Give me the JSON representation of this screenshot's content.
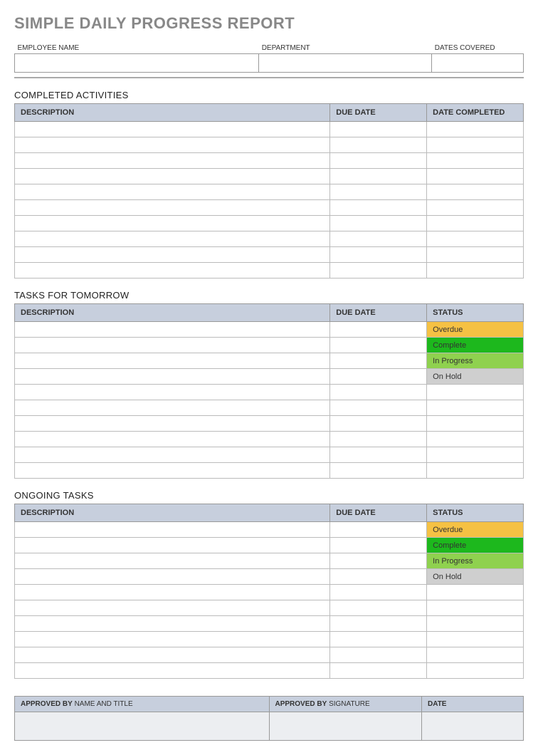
{
  "title": "SIMPLE DAILY PROGRESS REPORT",
  "header": {
    "employee_label": "EMPLOYEE NAME",
    "department_label": "DEPARTMENT",
    "dates_label": "DATES COVERED",
    "employee_value": "",
    "department_value": "",
    "dates_value": ""
  },
  "completed": {
    "title": "COMPLETED ACTIVITIES",
    "col_description": "DESCRIPTION",
    "col_due": "DUE DATE",
    "col_completed": "DATE COMPLETED",
    "rows": [
      {
        "description": "",
        "due": "",
        "completed": ""
      },
      {
        "description": "",
        "due": "",
        "completed": ""
      },
      {
        "description": "",
        "due": "",
        "completed": ""
      },
      {
        "description": "",
        "due": "",
        "completed": ""
      },
      {
        "description": "",
        "due": "",
        "completed": ""
      },
      {
        "description": "",
        "due": "",
        "completed": ""
      },
      {
        "description": "",
        "due": "",
        "completed": ""
      },
      {
        "description": "",
        "due": "",
        "completed": ""
      },
      {
        "description": "",
        "due": "",
        "completed": ""
      },
      {
        "description": "",
        "due": "",
        "completed": ""
      }
    ]
  },
  "tomorrow": {
    "title": "TASKS FOR TOMORROW",
    "col_description": "DESCRIPTION",
    "col_due": "DUE DATE",
    "col_status": "STATUS",
    "rows": [
      {
        "description": "",
        "due": "",
        "status": "Overdue",
        "status_class": "status-overdue"
      },
      {
        "description": "",
        "due": "",
        "status": "Complete",
        "status_class": "status-complete"
      },
      {
        "description": "",
        "due": "",
        "status": "In Progress",
        "status_class": "status-inprogress"
      },
      {
        "description": "",
        "due": "",
        "status": "On Hold",
        "status_class": "status-onhold"
      },
      {
        "description": "",
        "due": "",
        "status": "",
        "status_class": ""
      },
      {
        "description": "",
        "due": "",
        "status": "",
        "status_class": ""
      },
      {
        "description": "",
        "due": "",
        "status": "",
        "status_class": ""
      },
      {
        "description": "",
        "due": "",
        "status": "",
        "status_class": ""
      },
      {
        "description": "",
        "due": "",
        "status": "",
        "status_class": ""
      },
      {
        "description": "",
        "due": "",
        "status": "",
        "status_class": ""
      }
    ]
  },
  "ongoing": {
    "title": "ONGOING TASKS",
    "col_description": "DESCRIPTION",
    "col_due": "DUE DATE",
    "col_status": "STATUS",
    "rows": [
      {
        "description": "",
        "due": "",
        "status": "Overdue",
        "status_class": "status-overdue"
      },
      {
        "description": "",
        "due": "",
        "status": "Complete",
        "status_class": "status-complete"
      },
      {
        "description": "",
        "due": "",
        "status": "In Progress",
        "status_class": "status-inprogress"
      },
      {
        "description": "",
        "due": "",
        "status": "On Hold",
        "status_class": "status-onhold"
      },
      {
        "description": "",
        "due": "",
        "status": "",
        "status_class": ""
      },
      {
        "description": "",
        "due": "",
        "status": "",
        "status_class": ""
      },
      {
        "description": "",
        "due": "",
        "status": "",
        "status_class": ""
      },
      {
        "description": "",
        "due": "",
        "status": "",
        "status_class": ""
      },
      {
        "description": "",
        "due": "",
        "status": "",
        "status_class": ""
      },
      {
        "description": "",
        "due": "",
        "status": "",
        "status_class": ""
      }
    ]
  },
  "approval": {
    "approved_by_bold": "APPROVED BY",
    "name_title": " NAME AND TITLE",
    "signature": " SIGNATURE",
    "date_bold": "DATE"
  }
}
